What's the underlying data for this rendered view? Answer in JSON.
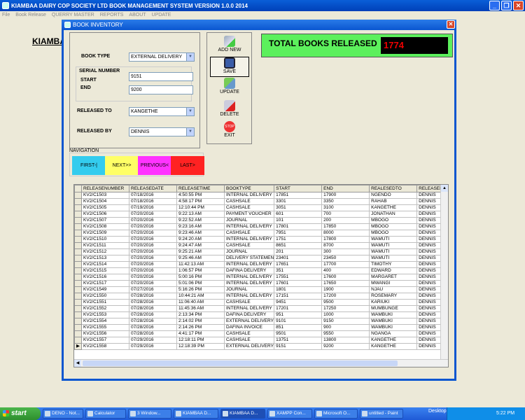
{
  "main_window": {
    "title": "KIAMBAA DAIRY COP SOCIETY LTD BOOK MANAGEMENT SYSTEM VERSION 1.0.0 2014",
    "menu": [
      "File",
      "Book Release",
      "QUERRY MASTER",
      "REPORTS",
      "ABOUT",
      "UPDATE"
    ],
    "bg_heading": "KIAMBA"
  },
  "child_window": {
    "title": "BOOK INVENTORY"
  },
  "form": {
    "book_type_label": "BOOK TYPE",
    "book_type_value": "EXTERNAL DELIVERY",
    "serial_number_label": "SERIAL NUMBER",
    "start_label": "START",
    "start_value": "9151",
    "end_label": "END",
    "end_value": "9200",
    "released_to_label": "RELEASED TO",
    "released_to_value": "KANGETHE",
    "released_by_label": "RELEASED BY",
    "released_by_value": "DENNIS"
  },
  "toolbar": {
    "add_new": "ADD NEW",
    "save": "SAVE",
    "update": "UPDATE",
    "delete": "DELETE",
    "exit": "EXIT"
  },
  "total": {
    "label": "TOTAL BOOKS RELEASED",
    "value": "1774"
  },
  "navigation": {
    "label": "NAVIGATION",
    "first": "FIRST-|",
    "next": "NEXT>>",
    "previous": "PREVIOUS<",
    "last": "LAST>"
  },
  "grid": {
    "columns": [
      "RELEASENUMBER",
      "RELEASEDATE",
      "RELEASETIME",
      "BOOKTYPE",
      "START",
      "END",
      "REALESEDTO",
      "RELEASEDI"
    ],
    "rows": [
      [
        "KV2/C1503",
        "07/18/2016",
        "4:50:55 PM",
        "INTERNAL DELIVERY",
        "17851",
        "17900",
        "NGENDO",
        "DENNIS"
      ],
      [
        "KV2/C1504",
        "07/18/2016",
        "4:58:17 PM",
        "CASHSALE",
        "3301",
        "3350",
        "RAHAB",
        "DENNIS"
      ],
      [
        "KV2/C1505",
        "07/19/2016",
        "12:10:44 PM",
        "CASHSALE",
        "3051",
        "3100",
        "KANGETHE",
        "DENNIS"
      ],
      [
        "KV2/C1506",
        "07/20/2016",
        "9:22:13 AM",
        "PAYMENT VOUCHER",
        "601",
        "700",
        "JONATHAN",
        "DENNIS"
      ],
      [
        "KV2/C1507",
        "07/20/2016",
        "9:22:52 AM",
        "JOURNAL",
        "101",
        "200",
        "MBOGO",
        "DENNIS"
      ],
      [
        "KV2/C1508",
        "07/20/2016",
        "9:23:16 AM",
        "INTERNAL DELIVERY",
        "17801",
        "17850",
        "MBOGO",
        "DENNIS"
      ],
      [
        "KV2/C1509",
        "07/20/2016",
        "9:23:46 AM",
        "CASHSALE",
        "7951",
        "8000",
        "MBOGO",
        "DENNIS"
      ],
      [
        "KV2/C1510",
        "07/20/2016",
        "9:24:20 AM",
        "INTERNAL DELIVERY",
        "1751",
        "17800",
        "WAMUTI",
        "DENNIS"
      ],
      [
        "KV2/C1511",
        "07/20/2016",
        "9:24:47 AM",
        "CASHSALE",
        "8651",
        "8700",
        "WAMUTI",
        "DENNIS"
      ],
      [
        "KV2/C1512",
        "07/20/2016",
        "9:25:21 AM",
        "JOURNAL",
        "201",
        "300",
        "WAMUTI",
        "DENNIS"
      ],
      [
        "KV2/C1513",
        "07/20/2016",
        "9:25:46 AM",
        "DELIVERY STATEMEN",
        "23401",
        "23450",
        "WAMUTI",
        "DENNIS"
      ],
      [
        "KV2/C1514",
        "07/20/2016",
        "11:42:13 AM",
        "INTERNAL DELIVERY",
        "17651",
        "17700",
        "TIMOTHY",
        "DENNIS"
      ],
      [
        "KV2/C1515",
        "07/20/2016",
        "1:06:57 PM",
        "DAFINA DELIVERY",
        "351",
        "400",
        "EDWARD",
        "DENNIS"
      ],
      [
        "KV2/C1516",
        "07/20/2016",
        "5:00:16 PM",
        "INTERNAL DELIVERY",
        "17551",
        "17600",
        "MARGARET",
        "DENNIS"
      ],
      [
        "KV2/C1517",
        "07/20/2016",
        "5:01:06 PM",
        "INTERNAL DELIVERY",
        "17601",
        "17650",
        "MWANGI",
        "DENNIS"
      ],
      [
        "KV2/C1549",
        "07/27/2016",
        "5:16:26 PM",
        "JOURNAL",
        "1801",
        "1900",
        "NJAU",
        "DENNIS"
      ],
      [
        "KV2/C1550",
        "07/28/2016",
        "10:44:21 AM",
        "INTERNAL DELIVERY",
        "17151",
        "17200",
        "ROSEMARY",
        "DENNIS"
      ],
      [
        "KV2/C1551",
        "07/28/2016",
        "11:06:40 AM",
        "CASHSALE",
        "9451",
        "9500",
        "KARIUKI",
        "DENNIS"
      ],
      [
        "KV2/C1552",
        "07/28/2016",
        "11:45:36 AM",
        "INTERNAL DELIVERY",
        "17201",
        "17250",
        "MUMBUNGE",
        "DENNIS"
      ],
      [
        "KV2/C1553",
        "07/28/2016",
        "2:13:34 PM",
        "DAFINA DELIVERY",
        "951",
        "1000",
        "WAMBUKI",
        "DENNIS"
      ],
      [
        "KV2/C1554",
        "07/28/2016",
        "2:14:02 PM",
        "EXTERNAL DELIVERY",
        "9101",
        "9150",
        "WAMBUKI",
        "DENNIS"
      ],
      [
        "KV2/C1555",
        "07/28/2016",
        "2:14:26 PM",
        "DAFINA INVOICE",
        "851",
        "900",
        "WAMBUKI",
        "DENNIS"
      ],
      [
        "KV2/C1556",
        "07/28/2016",
        "4:41:17 PM",
        "CASHSALE",
        "9501",
        "9550",
        "NGANGA",
        "DENNIS"
      ],
      [
        "KV2/C1557",
        "07/29/2016",
        "12:18:11 PM",
        "CASHSALE",
        "13751",
        "13800",
        "KANGETHE",
        "DENNIS"
      ],
      [
        "KV2/C1558",
        "07/29/2016",
        "12:18:39 PM",
        "EXTERNAL DELIVERY",
        "9151",
        "9200",
        "KANGETHE",
        "DENNIS"
      ]
    ],
    "current_row_marker": "▶"
  },
  "taskbar": {
    "start": "start",
    "tasks": [
      "DENO - Not...",
      "Calculator",
      "3 Window...",
      "KIAMBAA D...",
      "KIAMBAA D...",
      "XAMPP Con...",
      "Microsoft O...",
      "untitled - Paint"
    ],
    "desktop": "Desktop",
    "clock": "5:22 PM"
  },
  "colors": {
    "total_panel": "#5cf05c",
    "first_btn": "#33ccee",
    "next_btn": "#ffff66",
    "previous_btn": "#ff33ff",
    "last_btn": "#ff2222"
  }
}
